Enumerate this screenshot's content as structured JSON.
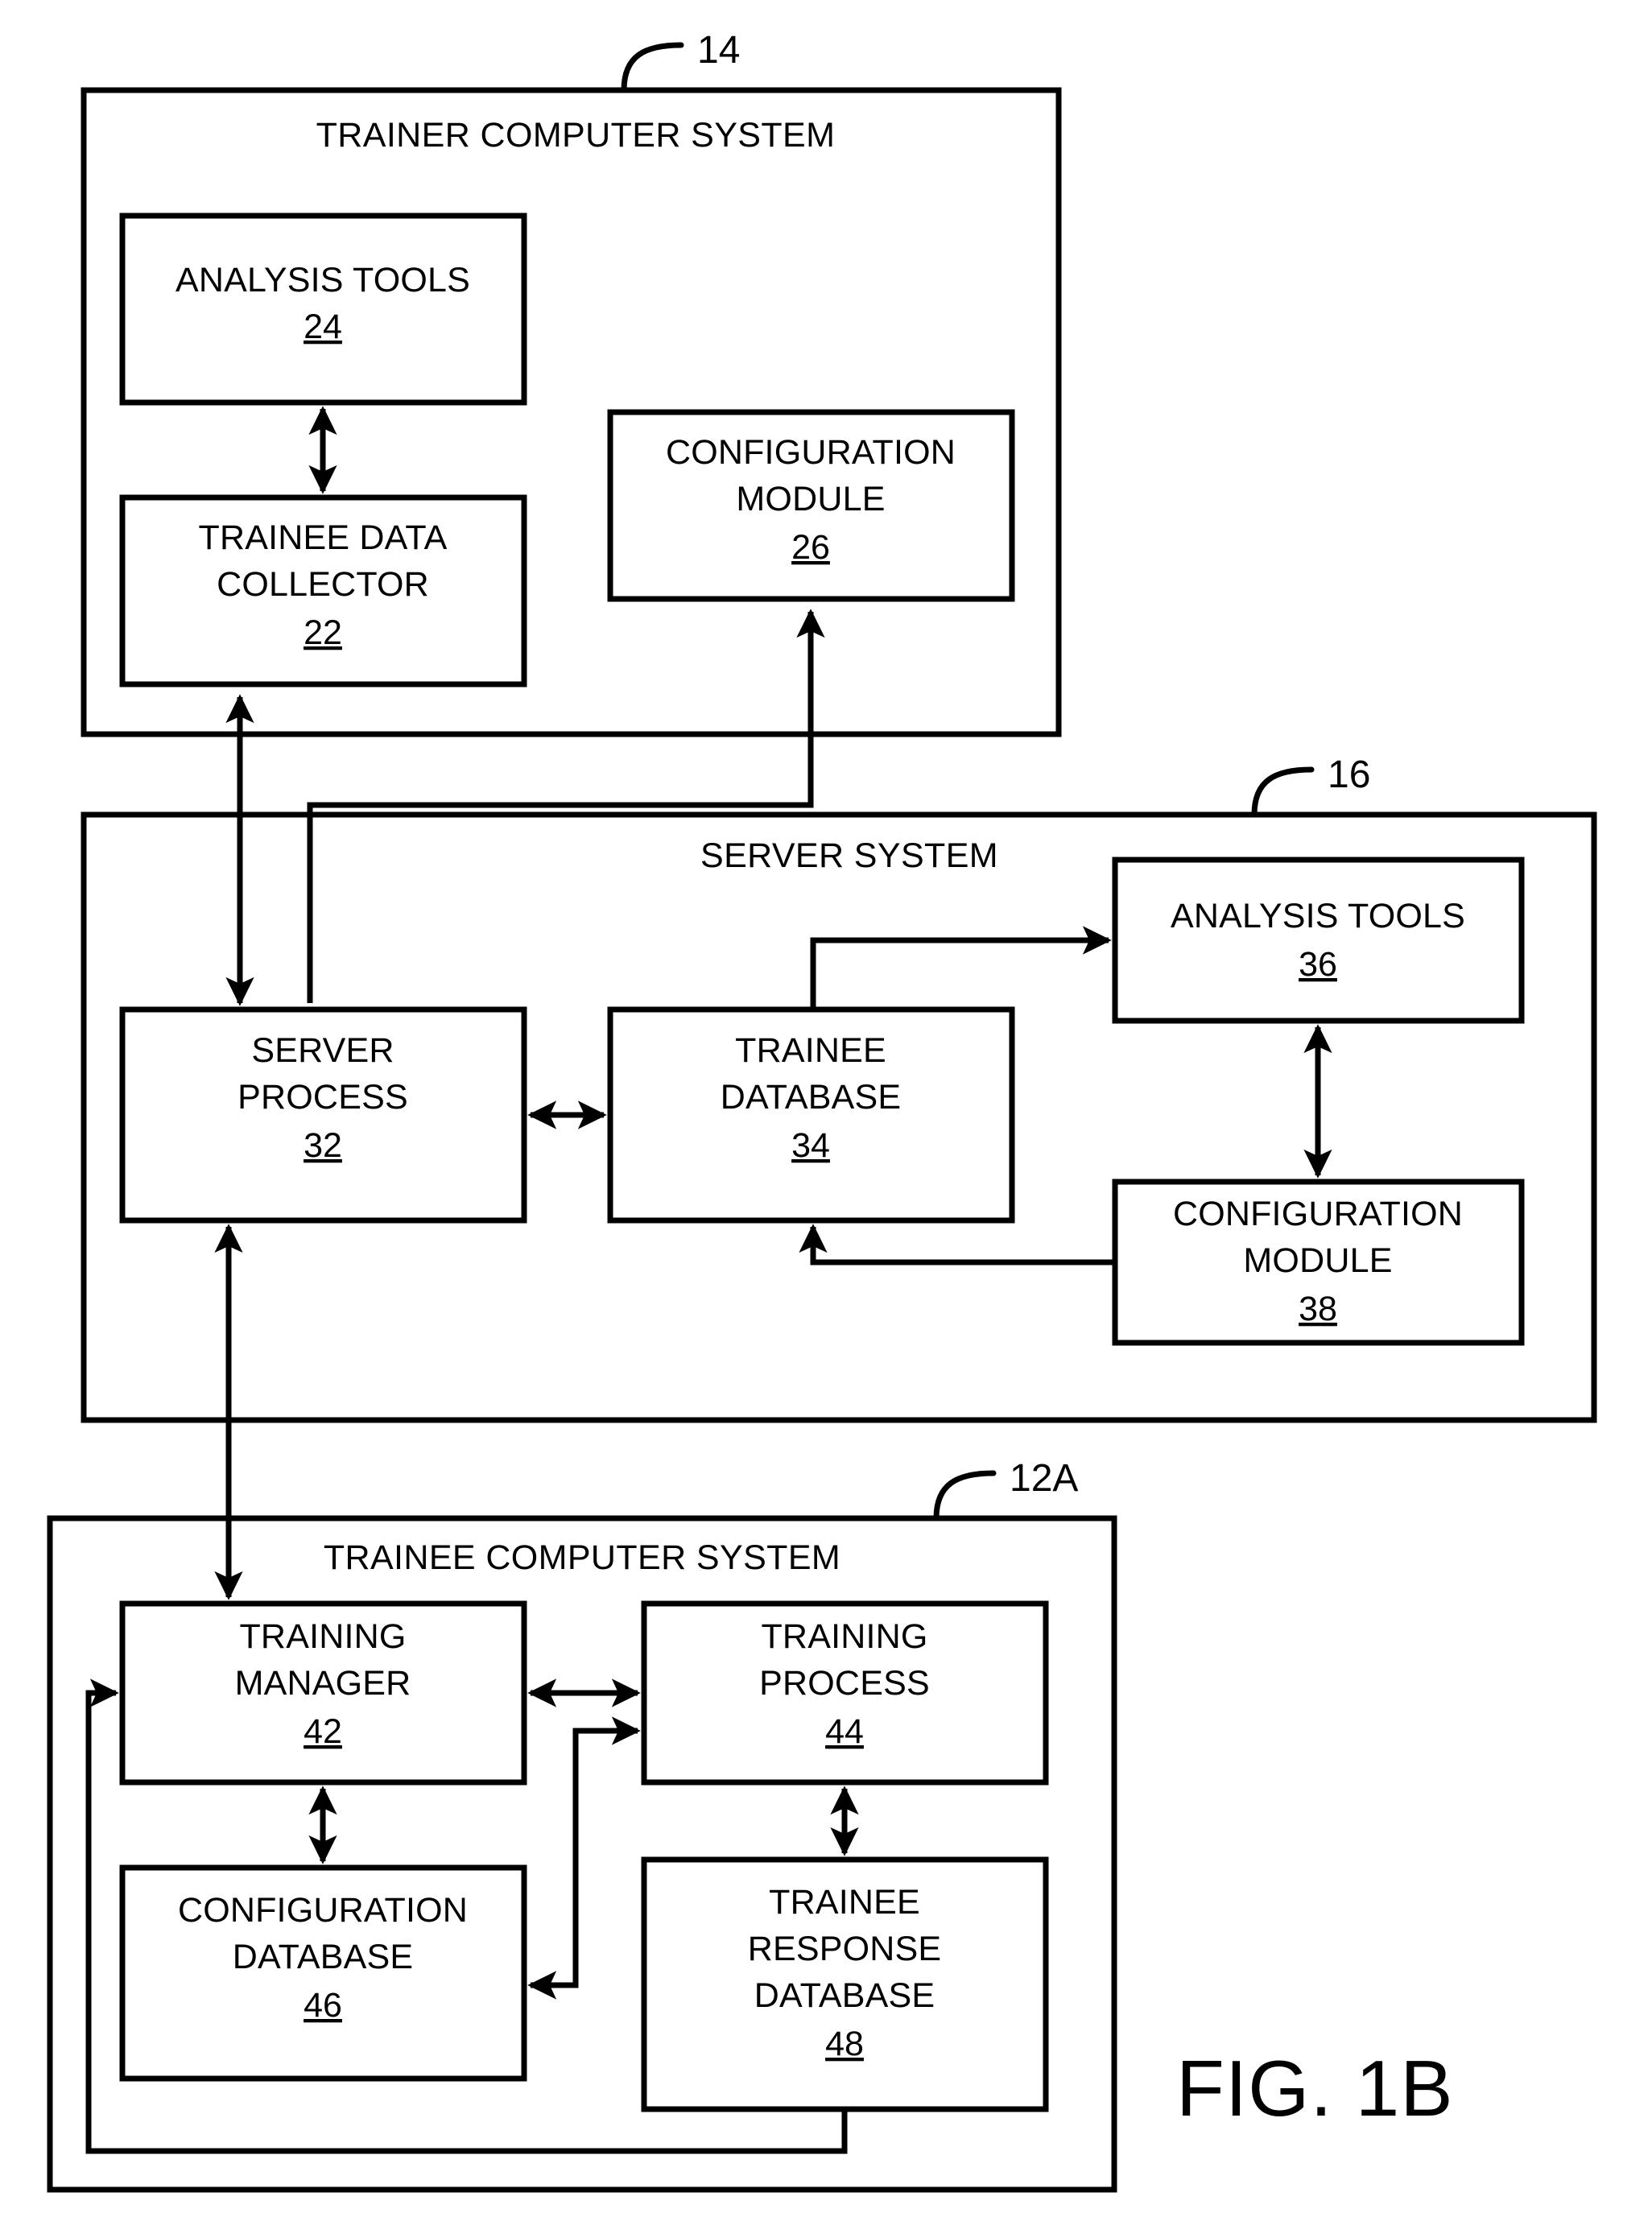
{
  "figure": {
    "label": "FIG. 1B",
    "callouts": [
      {
        "id": "trainer",
        "ref": "14"
      },
      {
        "id": "server",
        "ref": "16"
      },
      {
        "id": "trainee",
        "ref": "12A"
      }
    ]
  },
  "panels": [
    {
      "id": "trainer-computer-system",
      "title": "TRAINER COMPUTER SYSTEM",
      "ref": "14",
      "boxes": [
        {
          "id": "analysis-tools-24",
          "lines": [
            "ANALYSIS TOOLS"
          ],
          "ref": "24"
        },
        {
          "id": "trainee-data-collector-22",
          "lines": [
            "TRAINEE DATA",
            "COLLECTOR"
          ],
          "ref": "22"
        },
        {
          "id": "configuration-module-26",
          "lines": [
            "CONFIGURATION",
            "MODULE"
          ],
          "ref": "26"
        }
      ]
    },
    {
      "id": "server-system",
      "title": "SERVER SYSTEM",
      "ref": "16",
      "boxes": [
        {
          "id": "server-process-32",
          "lines": [
            "SERVER",
            "PROCESS"
          ],
          "ref": "32"
        },
        {
          "id": "trainee-database-34",
          "lines": [
            "TRAINEE",
            "DATABASE"
          ],
          "ref": "34"
        },
        {
          "id": "analysis-tools-36",
          "lines": [
            "ANALYSIS TOOLS"
          ],
          "ref": "36"
        },
        {
          "id": "configuration-module-38",
          "lines": [
            "CONFIGURATION",
            "MODULE"
          ],
          "ref": "38"
        }
      ]
    },
    {
      "id": "trainee-computer-system",
      "title": "TRAINEE COMPUTER SYSTEM",
      "ref": "12A",
      "boxes": [
        {
          "id": "training-manager-42",
          "lines": [
            "TRAINING",
            "MANAGER"
          ],
          "ref": "42"
        },
        {
          "id": "training-process-44",
          "lines": [
            "TRAINING",
            "PROCESS"
          ],
          "ref": "44"
        },
        {
          "id": "configuration-database-46",
          "lines": [
            "CONFIGURATION",
            "DATABASE"
          ],
          "ref": "46"
        },
        {
          "id": "trainee-response-database-48",
          "lines": [
            "TRAINEE",
            "RESPONSE",
            "DATABASE"
          ],
          "ref": "48"
        }
      ]
    }
  ],
  "connections": [
    {
      "from": "analysis-tools-24",
      "to": "trainee-data-collector-22",
      "arrows": "both"
    },
    {
      "from": "server-process-32",
      "to": "trainee-data-collector-22",
      "arrows": "both"
    },
    {
      "from": "server-process-32",
      "to": "configuration-module-26",
      "arrows": "to"
    },
    {
      "from": "server-process-32",
      "to": "trainee-database-34",
      "arrows": "both"
    },
    {
      "from": "trainee-database-34",
      "to": "analysis-tools-36",
      "arrows": "to"
    },
    {
      "from": "analysis-tools-36",
      "to": "configuration-module-38",
      "arrows": "both"
    },
    {
      "from": "configuration-module-38",
      "to": "trainee-database-34",
      "arrows": "to"
    },
    {
      "from": "server-process-32",
      "to": "training-manager-42",
      "arrows": "both"
    },
    {
      "from": "training-manager-42",
      "to": "training-process-44",
      "arrows": "both"
    },
    {
      "from": "training-manager-42",
      "to": "configuration-database-46",
      "arrows": "both"
    },
    {
      "from": "training-process-44",
      "to": "trainee-response-database-48",
      "arrows": "both"
    },
    {
      "from": "configuration-database-46",
      "to": "training-process-44",
      "arrows": "to"
    },
    {
      "from": "trainee-response-database-48",
      "to": "configuration-database-46",
      "arrows": "to"
    },
    {
      "from": "trainee-response-database-48",
      "to": "training-manager-42",
      "arrows": "to"
    }
  ],
  "colors": {
    "ink": "#000000",
    "paper": "#ffffff"
  }
}
